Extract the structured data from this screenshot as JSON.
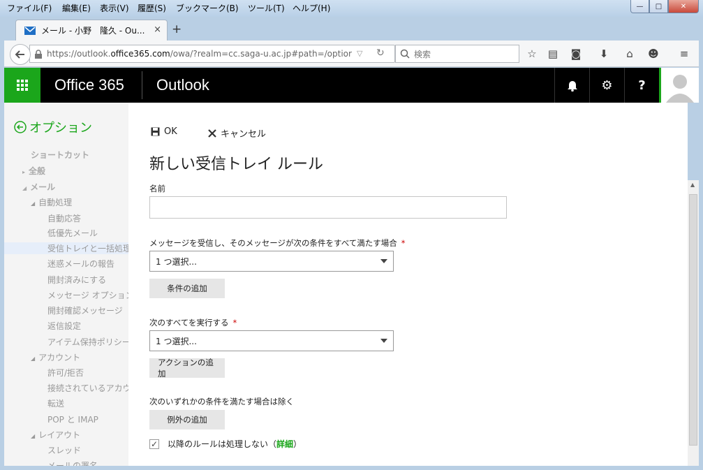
{
  "menubar": {
    "items": [
      "ファイル(F)",
      "編集(E)",
      "表示(V)",
      "履歴(S)",
      "ブックマーク(B)",
      "ツール(T)",
      "ヘルプ(H)"
    ]
  },
  "window_buttons": {
    "minimize": "—",
    "maximize": "□",
    "close": "✕"
  },
  "tab": {
    "title": "メール - 小野　隆久 - Ou...",
    "close": "×",
    "new_tab": "+"
  },
  "address": {
    "url_prefix": "https://outlook.",
    "url_domain": "office365.com",
    "url_rest": "/owa/?realm=cc.saga-u.ac.jp#path=/optior",
    "search_placeholder": "検索"
  },
  "header": {
    "brand": "Office 365",
    "app": "Outlook",
    "bell": "🔔",
    "gear": "⚙",
    "help": "?"
  },
  "leftnav": {
    "title": "オプション",
    "items": [
      {
        "label": "ショートカット",
        "level": 0
      },
      {
        "label": "全般",
        "level": 0,
        "prefix": "▸"
      },
      {
        "label": "メール",
        "level": 0,
        "prefix": "◢"
      },
      {
        "label": "自動処理",
        "level": 1,
        "prefix": "◢"
      },
      {
        "label": "自動応答",
        "level": 2
      },
      {
        "label": "低優先メール",
        "level": 2
      },
      {
        "label": "受信トレイと一括処理ル",
        "level": 2,
        "selected": true
      },
      {
        "label": "迷惑メールの報告",
        "level": 2
      },
      {
        "label": "開封済みにする",
        "level": 2
      },
      {
        "label": "メッセージ オプション",
        "level": 2
      },
      {
        "label": "開封確認メッセージ",
        "level": 2
      },
      {
        "label": "返信設定",
        "level": 2
      },
      {
        "label": "アイテム保持ポリシー",
        "level": 2
      },
      {
        "label": "アカウント",
        "level": 1,
        "prefix": "◢"
      },
      {
        "label": "許可/拒否",
        "level": 2
      },
      {
        "label": "接続されているアカウント",
        "level": 2
      },
      {
        "label": "転送",
        "level": 2
      },
      {
        "label": "POP と IMAP",
        "level": 2
      },
      {
        "label": "レイアウト",
        "level": 1,
        "prefix": "◢"
      },
      {
        "label": "スレッド",
        "level": 2
      },
      {
        "label": "メールの署名",
        "level": 2
      }
    ]
  },
  "form": {
    "ok": "OK",
    "cancel": "キャンセル",
    "title": "新しい受信トレイ ルール",
    "name_label": "名前",
    "name_value": "",
    "condition_label": "メッセージを受信し、そのメッセージが次の条件をすべて満たす場合",
    "required_mark": "*",
    "condition_select": "1 つ選択...",
    "add_condition": "条件の追加",
    "action_label": "次のすべてを実行する",
    "action_select": "1 つ選択...",
    "add_action": "アクションの追加",
    "exception_label": "次のいずれかの条件を満たす場合は除く",
    "add_exception": "例外の追加",
    "stop_label": "以降のルールは処理しない",
    "stop_checked": true,
    "details_open": "（",
    "details_link": "詳細",
    "details_close": "）"
  },
  "colors": {
    "accent": "#1ba61b",
    "header_bg": "#000000"
  }
}
